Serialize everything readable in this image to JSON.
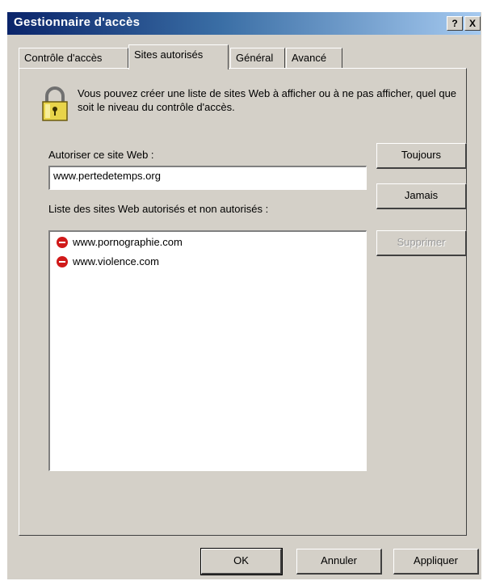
{
  "window": {
    "title": "Gestionnaire d'accès",
    "help_label": "?",
    "close_label": "X"
  },
  "tabs": [
    {
      "label": "Contrôle d'accès",
      "active": false
    },
    {
      "label": "Sites autorisés",
      "active": true
    },
    {
      "label": "Général",
      "active": false
    },
    {
      "label": "Avancé",
      "active": false
    }
  ],
  "panel": {
    "intro_text": "Vous pouvez créer une liste de sites Web à afficher ou à ne pas afficher, quel que soit le niveau du contrôle d'accès.",
    "url_label": "Autoriser ce site Web :",
    "url_value": "www.pertedetemps.org",
    "list_label": "Liste des sites Web autorisés et non autorisés :",
    "sites": [
      {
        "url": "www.pornographie.com",
        "status": "blocked",
        "icon": "block-icon"
      },
      {
        "url": "www.violence.com",
        "status": "blocked",
        "icon": "block-icon"
      }
    ],
    "always_button": "Toujours",
    "never_button": "Jamais",
    "remove_button": "Supprimer"
  },
  "footer": {
    "ok_button": "OK",
    "cancel_button": "Annuler",
    "apply_button": "Appliquer"
  },
  "colors": {
    "dialog_bg": "#d4d0c8",
    "title_start": "#0a246a",
    "title_end": "#a6caf0",
    "block_red": "#d01a1a"
  }
}
